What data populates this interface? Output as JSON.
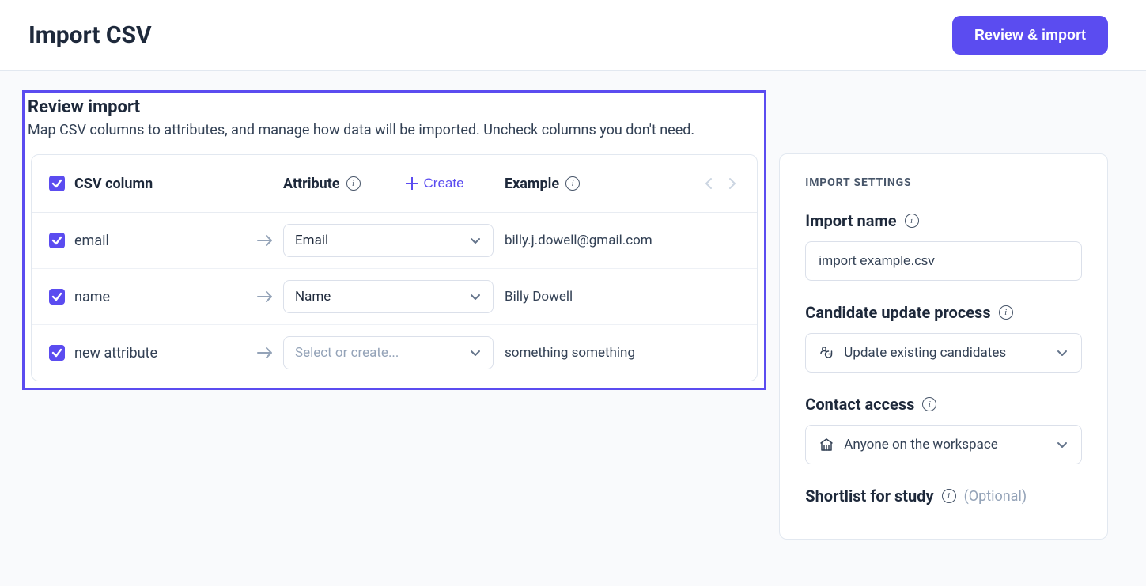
{
  "header": {
    "title": "Import CSV",
    "primary_button": "Review & import"
  },
  "review": {
    "title": "Review import",
    "subtitle": "Map CSV columns to attributes, and manage how data will be imported. Uncheck columns you don't need.",
    "columns": {
      "csv": "CSV column",
      "attribute": "Attribute",
      "create": "Create",
      "example": "Example"
    },
    "rows": [
      {
        "csv": "email",
        "attribute": "Email",
        "placeholder": false,
        "example": "billy.j.dowell@gmail.com"
      },
      {
        "csv": "name",
        "attribute": "Name",
        "placeholder": false,
        "example": "Billy Dowell"
      },
      {
        "csv": "new attribute",
        "attribute": "Select or create...",
        "placeholder": true,
        "example": "something something"
      }
    ]
  },
  "settings": {
    "heading": "IMPORT SETTINGS",
    "import_name": {
      "label": "Import name",
      "value": "import example.csv"
    },
    "update_process": {
      "label": "Candidate update process",
      "value": "Update existing candidates"
    },
    "contact_access": {
      "label": "Contact access",
      "value": "Anyone on the workspace"
    },
    "shortlist": {
      "label": "Shortlist for study",
      "optional": "(Optional)"
    }
  }
}
